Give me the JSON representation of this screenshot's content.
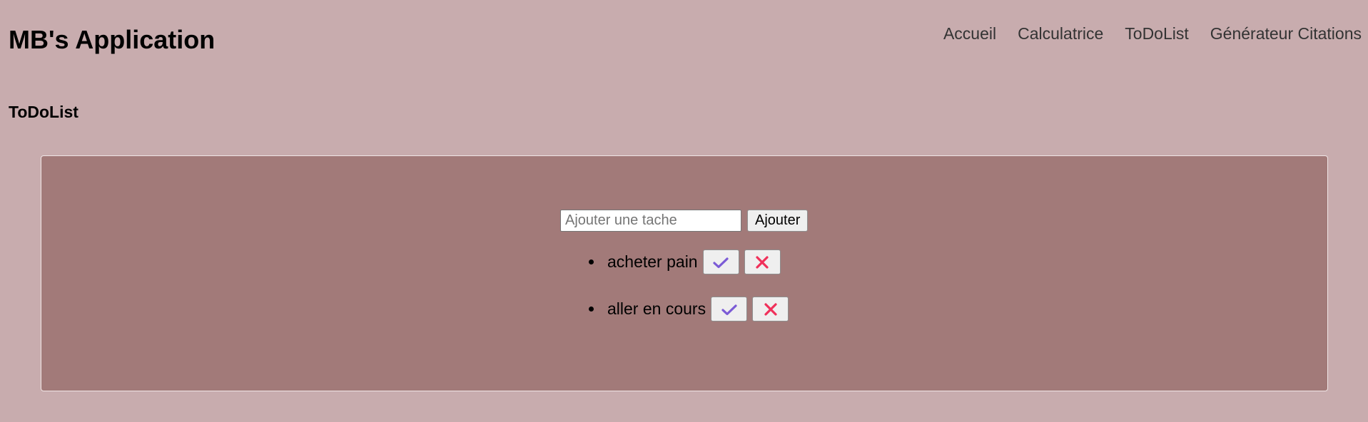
{
  "header": {
    "brand": "MB's Application",
    "nav": [
      "Accueil",
      "Calculatrice",
      "ToDoList",
      "Générateur Citations"
    ]
  },
  "page": {
    "title": "ToDoList"
  },
  "todo": {
    "input_placeholder": "Ajouter une tache",
    "input_value": "",
    "add_label": "Ajouter",
    "tasks": [
      {
        "text": "acheter pain"
      },
      {
        "text": "aller en cours"
      }
    ],
    "complete_icon": "check-icon",
    "delete_icon": "close-icon",
    "colors": {
      "check": "#7b5bd6",
      "cross": "#f0305a",
      "panel": "#a27a79",
      "background": "#c8acae"
    }
  }
}
